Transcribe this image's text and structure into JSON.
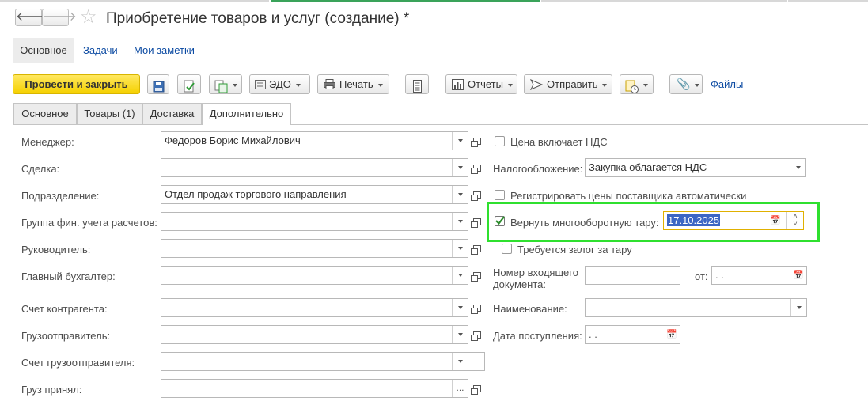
{
  "window": {
    "title": "Приобретение товаров и услуг (создание) *"
  },
  "section_nav": {
    "main": "Основное",
    "tasks": "Задачи",
    "notes": "Мои заметки"
  },
  "toolbar": {
    "post_close": "Провести и закрыть",
    "edo": "ЭДО",
    "print": "Печать",
    "reports": "Отчеты",
    "send": "Отправить",
    "files": "Файлы"
  },
  "tabs": [
    {
      "label": "Основное"
    },
    {
      "label": "Товары (1)"
    },
    {
      "label": "Доставка"
    },
    {
      "label": "Дополнительно"
    }
  ],
  "left": {
    "manager_label": "Менеджер:",
    "manager_value": "Федоров Борис Михайлович",
    "deal_label": "Сделка:",
    "subdivision_label": "Подразделение:",
    "subdivision_value": "Отдел продаж торгового направления",
    "fin_group_label": "Группа фин. учета расчетов:",
    "head_label": "Руководитель:",
    "chief_accountant_label": "Главный бухгалтер:",
    "contractor_account_label": "Счет контрагента:",
    "shipper_label": "Грузоотправитель:",
    "shipper_account_label": "Счет грузоотправителя:",
    "cargo_accepted_label": "Груз принял:",
    "more_dots": "..."
  },
  "right": {
    "price_incl_vat": "Цена включает НДС",
    "taxation_label": "Налогообложение:",
    "taxation_value": "Закупка облагается НДС",
    "register_prices": "Регистрировать цены поставщика автоматически",
    "return_tare": "Вернуть многооборотную тару:",
    "return_tare_date": "17.10.2025",
    "deposit_required": "Требуется залог за тару",
    "incoming_doc_label": "Номер входящего документа:",
    "from_label": "от:",
    "from_value": " .  .",
    "name_label": "Наименование:",
    "receipt_date_label": "Дата поступления:",
    "receipt_date_value": " .  ."
  },
  "colors": {
    "primary": "#f5d000",
    "highlight": "#2fe02f",
    "link": "#0b4aa2",
    "active_tab_line": "#3aa35a"
  }
}
